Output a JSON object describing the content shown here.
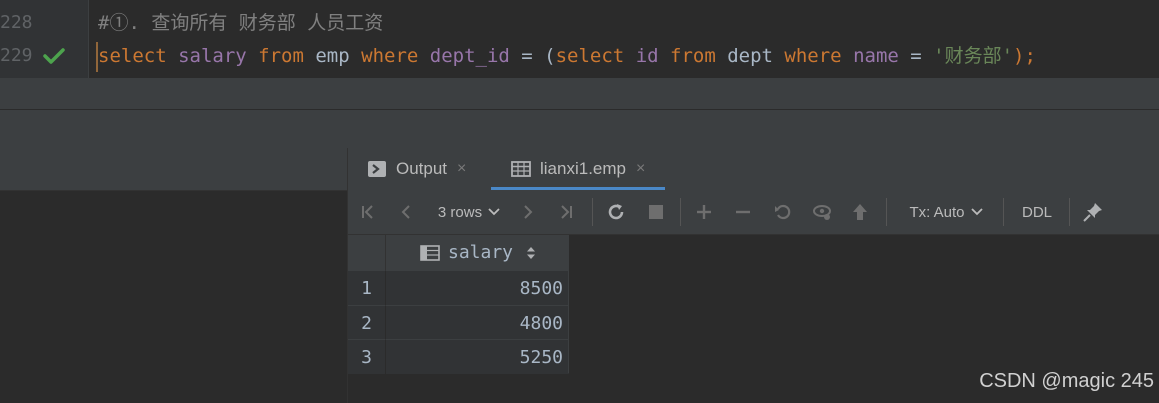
{
  "editor": {
    "lines": [
      {
        "number": "228",
        "comment": "#①. 查询所有 财务部 人员工资"
      },
      {
        "number": "229",
        "tokens": {
          "t1": "select",
          "t2": " salary",
          "t3": " from",
          "t4": " emp",
          "t5": " where",
          "t6": " dept_id",
          "t7": " = (",
          "t8": "select",
          "t9": " id",
          "t10": " from",
          "t11": " dept",
          "t12": " where",
          "t13": " name",
          "t14": " = ",
          "t15": "'财务部'",
          "t16": ");"
        }
      }
    ]
  },
  "tabs": {
    "output_label": "Output",
    "table_label": "lianxi1.emp",
    "close_glyph": "×"
  },
  "toolbar": {
    "rows_label": "3 rows",
    "tx_label": "Tx: Auto",
    "ddl_label": "DDL"
  },
  "grid": {
    "column_header": "salary",
    "rows": [
      {
        "num": "1",
        "salary": "8500"
      },
      {
        "num": "2",
        "salary": "4800"
      },
      {
        "num": "3",
        "salary": "5250"
      }
    ]
  },
  "watermark": "CSDN @magic 245",
  "colors": {
    "keyword": "#cc7832",
    "identifier": "#9876aa",
    "string": "#6a8759",
    "comment": "#808080",
    "check": "#4da34d",
    "tab_underline": "#4a88c7"
  },
  "icons": {
    "run_marker": "check-icon",
    "output_tab": "console-icon",
    "table_tab": "table-icon",
    "first": "first-page-icon",
    "prev": "prev-page-icon",
    "next": "next-page-icon",
    "last": "last-page-icon",
    "reload": "reload-icon",
    "stop": "stop-icon",
    "add": "add-row-icon",
    "remove": "remove-row-icon",
    "revert": "revert-icon",
    "preview": "preview-icon",
    "submit": "submit-icon",
    "pin": "pin-icon"
  }
}
